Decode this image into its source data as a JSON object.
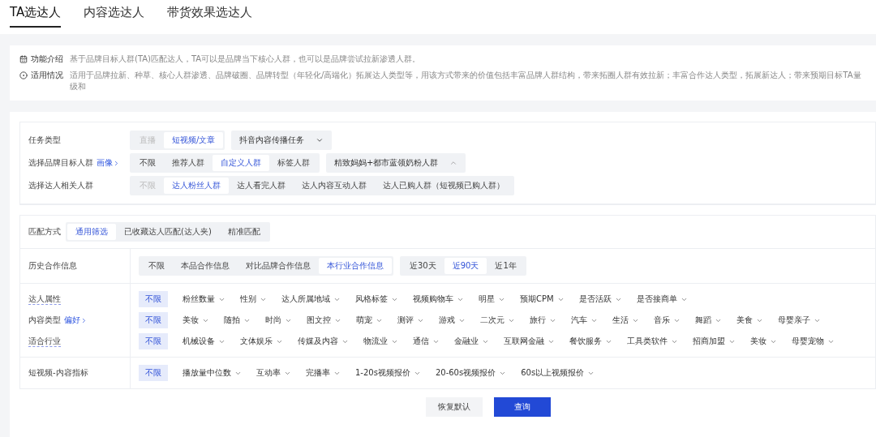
{
  "tabs": [
    {
      "label": "TA选达人",
      "selected": true
    },
    {
      "label": "内容选达人",
      "selected": false
    },
    {
      "label": "带货效果选达人",
      "selected": false
    }
  ],
  "intro": [
    {
      "kind": "intro",
      "label": "功能介绍",
      "text": "基于品牌目标人群(TA)匹配达人，TA可以是品牌当下核心人群，也可以是品牌尝试拉新渗透人群。"
    },
    {
      "kind": "usage",
      "label": "适用情况",
      "text": "适用于品牌拉新、种草、核心人群渗透、品牌破圈、品牌转型（年轻化/高端化）拓展达人类型等，用该方式带来的价值包括丰富品牌人群结构，带来拓圈人群有效拉新；丰富合作达人类型，拓展新达人；带来预期目标TA量级和"
    }
  ],
  "task_rows": [
    {
      "label": "任务类型",
      "groups": [
        {
          "kind": "segment",
          "options": [
            {
              "label": "直播",
              "selected": false,
              "disabled": true
            },
            {
              "label": "短视频/文章",
              "selected": true,
              "disabled": false
            }
          ]
        },
        {
          "kind": "dropdown",
          "value": "抖音内容传播任务",
          "expanded": false
        }
      ]
    },
    {
      "label": "选择品牌目标人群",
      "link": "画像",
      "groups": [
        {
          "kind": "segment",
          "options": [
            {
              "label": "不限",
              "selected": false,
              "disabled": false
            },
            {
              "label": "推荐人群",
              "selected": false,
              "disabled": false
            },
            {
              "label": "自定义人群",
              "selected": true,
              "disabled": false
            },
            {
              "label": "标签人群",
              "selected": false,
              "disabled": false
            }
          ]
        },
        {
          "kind": "dropdown",
          "value": "精致妈妈+都市蓝领奶粉人群",
          "expanded": true
        }
      ]
    },
    {
      "label": "选择达人相关人群",
      "groups": [
        {
          "kind": "segment",
          "options": [
            {
              "label": "不限",
              "selected": false,
              "disabled": true
            },
            {
              "label": "达人粉丝人群",
              "selected": true,
              "disabled": false
            },
            {
              "label": "达人看完人群",
              "selected": false,
              "disabled": false
            },
            {
              "label": "达人内容互动人群",
              "selected": false,
              "disabled": false
            },
            {
              "label": "达人已购人群（短视频已购人群）",
              "selected": false,
              "disabled": false
            }
          ]
        }
      ]
    }
  ],
  "match": {
    "label": "匹配方式",
    "options": [
      {
        "label": "通用筛选",
        "selected": true,
        "disabled": false
      },
      {
        "label": "已收藏达人匹配(达人夹)",
        "selected": false,
        "disabled": false
      },
      {
        "label": "精准匹配",
        "selected": false,
        "disabled": false
      }
    ]
  },
  "filter_sections": [
    {
      "rows": [
        {
          "label": "历史合作信息",
          "dotted": false,
          "groups": [
            {
              "kind": "segment",
              "options": [
                {
                  "label": "不限",
                  "selected": false,
                  "disabled": false
                },
                {
                  "label": "本品合作信息",
                  "selected": false,
                  "disabled": false
                },
                {
                  "label": "对比品牌合作信息",
                  "selected": false,
                  "disabled": false
                },
                {
                  "label": "本行业合作信息",
                  "selected": true,
                  "disabled": false
                }
              ]
            },
            {
              "kind": "segment",
              "options": [
                {
                  "label": "近30天",
                  "selected": false,
                  "disabled": false
                },
                {
                  "label": "近90天",
                  "selected": true,
                  "disabled": false
                },
                {
                  "label": "近1年",
                  "selected": false,
                  "disabled": false
                }
              ]
            }
          ]
        }
      ]
    },
    {
      "rows": [
        {
          "label": "达人属性",
          "dotted": true,
          "groups": [
            {
              "kind": "tag",
              "label": "不限",
              "selected": true
            },
            {
              "kind": "filters",
              "items": [
                "粉丝数量",
                "性别",
                "达人所属地域",
                "风格标签",
                "视频购物车",
                "明星",
                "预期CPM",
                "是否活跃",
                "是否接商单"
              ]
            }
          ]
        },
        {
          "label": "内容类型",
          "link": "偏好",
          "dotted": false,
          "groups": [
            {
              "kind": "tag",
              "label": "不限",
              "selected": true
            },
            {
              "kind": "filters",
              "items": [
                "美妆",
                "随拍",
                "时尚",
                "图文控",
                "萌宠",
                "测评",
                "游戏",
                "二次元",
                "旅行",
                "汽车",
                "生活",
                "音乐",
                "舞蹈",
                "美食",
                "母婴亲子"
              ]
            }
          ]
        },
        {
          "label": "适合行业",
          "dotted": true,
          "groups": [
            {
              "kind": "tag",
              "label": "不限",
              "selected": true
            },
            {
              "kind": "filters",
              "items": [
                "机械设备",
                "文体娱乐",
                "传媒及内容",
                "物流业",
                "通信",
                "金融业",
                "互联网金融",
                "餐饮服务",
                "工具类软件",
                "招商加盟",
                "美妆",
                "母婴宠物"
              ]
            }
          ]
        }
      ]
    },
    {
      "rows": [
        {
          "label": "短视频-内容指标",
          "dotted": false,
          "groups": [
            {
              "kind": "tag",
              "label": "不限",
              "selected": true
            },
            {
              "kind": "filters",
              "items": [
                "播放量中位数",
                "互动率",
                "完播率",
                "1-20s视频报价",
                "20-60s视频报价",
                "60s以上视频报价"
              ]
            }
          ]
        }
      ]
    }
  ],
  "buttons": [
    {
      "label": "恢复默认",
      "kind": "secondary"
    },
    {
      "label": "查询",
      "kind": "primary"
    }
  ]
}
